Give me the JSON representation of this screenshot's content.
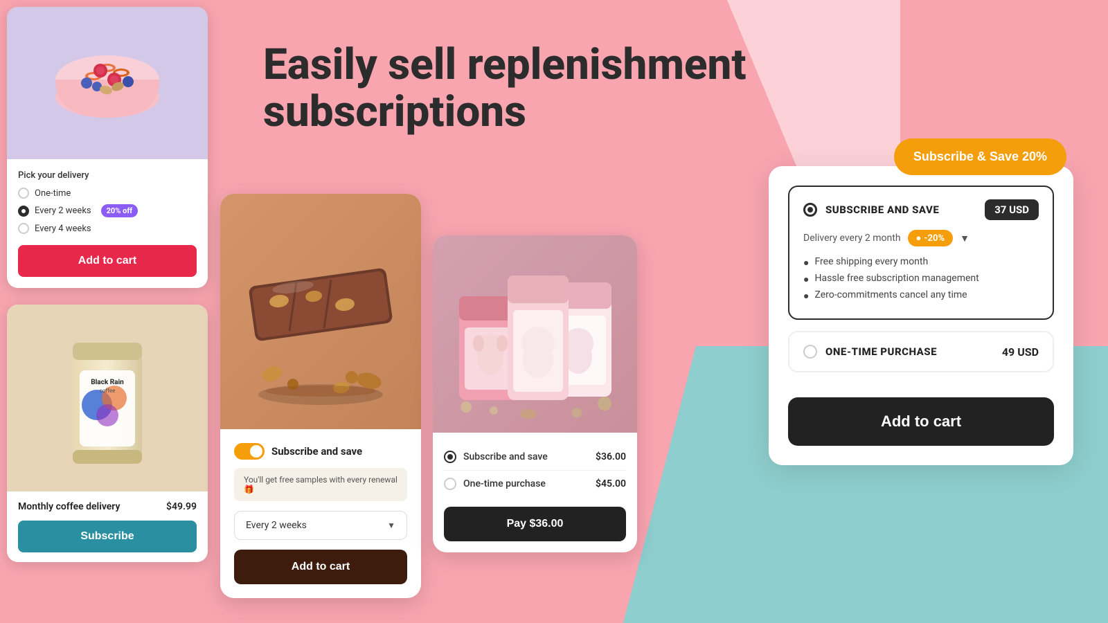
{
  "hero": {
    "title": "Easily sell replenishment subscriptions"
  },
  "subscribe_save_btn": "Subscribe & Save 20%",
  "card1": {
    "image_alt": "Cereal bowl with berries",
    "delivery_label": "Pick your delivery",
    "options": [
      {
        "label": "One-time",
        "selected": false
      },
      {
        "label": "Every 2 weeks",
        "selected": true,
        "badge": "20% off"
      },
      {
        "label": "Every 4 weeks",
        "selected": false
      }
    ],
    "add_to_cart": "Add to cart"
  },
  "card2": {
    "image_alt": "Black Rain Coffee bag",
    "product_name": "Monthly coffee delivery",
    "price": "$49.99",
    "subscribe_btn": "Subscribe"
  },
  "center_card": {
    "image_alt": "Chocolate almond bar",
    "toggle_on": true,
    "subscribe_save_label": "Subscribe and save",
    "free_samples_text": "You'll get free samples with every renewal 🎁",
    "frequency_label": "Every 2 weeks",
    "add_to_cart": "Add to cart"
  },
  "pet_card": {
    "image_alt": "Pet food bags",
    "subscribe_option": {
      "label": "Subscribe and save",
      "price": "$36.00",
      "selected": true
    },
    "onetime_option": {
      "label": "One-time purchase",
      "price": "$45.00",
      "selected": false
    },
    "pay_btn": "Pay  $36.00"
  },
  "widget": {
    "subscribe_title": "SUBSCRIBE AND SAVE",
    "subscribe_price": "37 USD",
    "delivery_label": "Delivery every 2 month",
    "discount": "-20%",
    "benefits": [
      "Free shipping every month",
      "Hassle free subscription management",
      "Zero-commitments cancel any time"
    ],
    "onetime_title": "ONE-TIME PURCHASE",
    "onetime_price": "49 USD",
    "add_to_cart": "Add to cart"
  }
}
